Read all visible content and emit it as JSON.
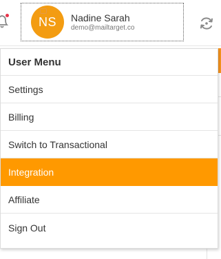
{
  "header": {
    "user": {
      "initials": "NS",
      "name": "Nadine Sarah",
      "email": "demo@mailtarget.co"
    },
    "icons": [
      "bell-icon",
      "sync-icon"
    ],
    "colors": {
      "accent": "#ff9900",
      "avatar": "#f39c12",
      "notification_dot": "#e8334a"
    }
  },
  "menu": {
    "title": "User Menu",
    "items": [
      {
        "label": "Settings"
      },
      {
        "label": "Billing"
      },
      {
        "label": "Switch to Transactional"
      },
      {
        "label": "Integration",
        "active": true
      },
      {
        "label": "Affiliate"
      },
      {
        "label": "Sign Out"
      }
    ]
  }
}
